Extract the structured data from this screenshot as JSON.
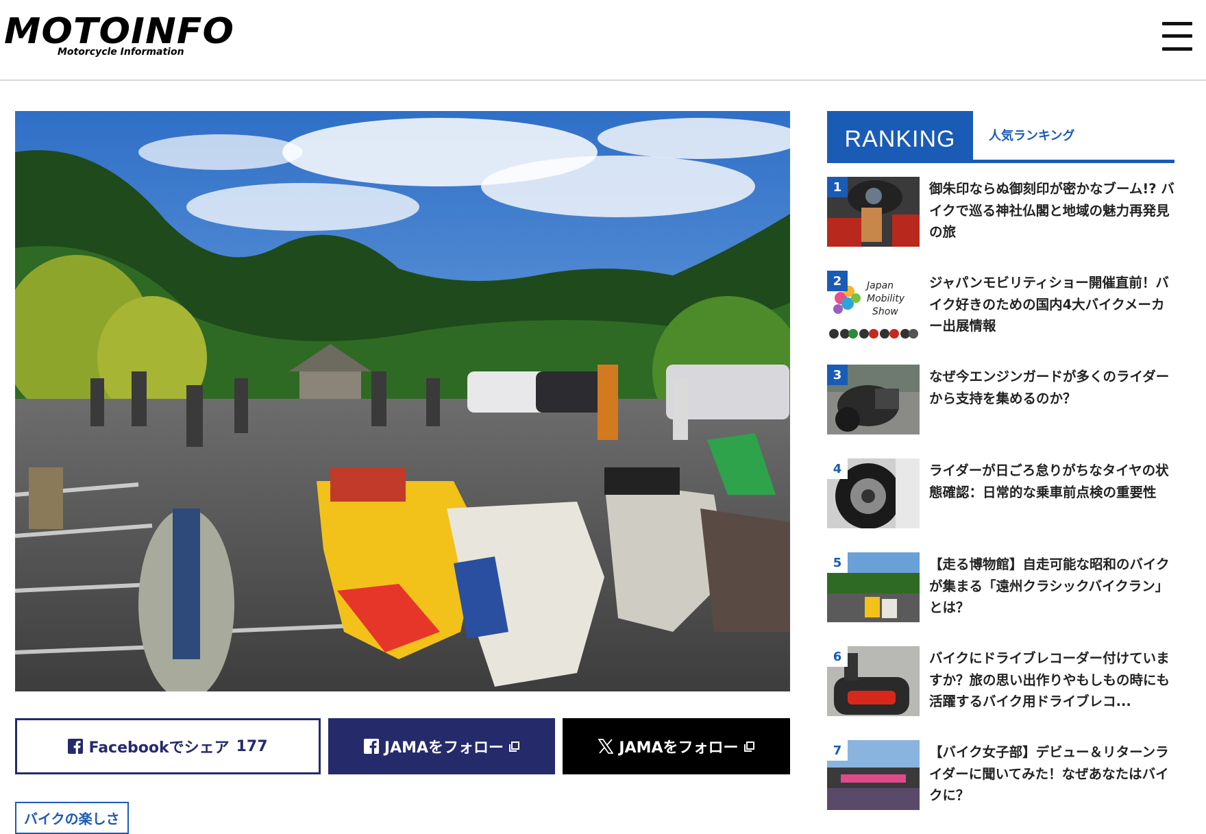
{
  "header": {
    "logo_text": "MOTOINFO",
    "logo_sub": "Motorcycle Information",
    "menu_icon": "hamburger-menu-icon"
  },
  "hero": {
    "image": "classic-motorcycle-meet-photo"
  },
  "share": {
    "facebook_label": "Facebookでシェア",
    "facebook_count": "177",
    "jama_facebook_label": "JAMAをフォロー",
    "jama_x_label": "JAMAをフォロー"
  },
  "tag": {
    "label": "バイクの楽しさ"
  },
  "ranking": {
    "title": "RANKING",
    "subtitle": "人気ランキング",
    "accent": "#1a5bb5",
    "items": [
      {
        "rank": "1",
        "title": "御朱印ならぬ御刻印が密かなブーム!? バイクで巡る神社仏閣と地域の魅力再発見の旅"
      },
      {
        "rank": "2",
        "title": "ジャパンモビリティショー開催直前！バイク好きのための国内4大バイクメーカー出展情報"
      },
      {
        "rank": "3",
        "title": "なぜ今エンジンガードが多くのライダーから支持を集めるのか？"
      },
      {
        "rank": "4",
        "title": "ライダーが日ごろ怠りがちなタイヤの状態確認：日常的な乗車前点検の重要性"
      },
      {
        "rank": "5",
        "title": "【走る博物館】自走可能な昭和のバイクが集まる「遠州クラシックバイクラン」とは？"
      },
      {
        "rank": "6",
        "title": "バイクにドライブレコーダー付けていますか？旅の思い出作りやもしもの時にも活躍するバイク用ドライブレコ..."
      },
      {
        "rank": "7",
        "title": "【バイク女子部】デビュー＆リターンライダーに聞いてみた！なぜあなたはバイクに？"
      }
    ],
    "thumb2_text": [
      "Japan",
      "Mobility",
      "Show"
    ]
  },
  "colors": {
    "navy": "#252a6b",
    "blue": "#1a5bb5",
    "black": "#000000"
  }
}
